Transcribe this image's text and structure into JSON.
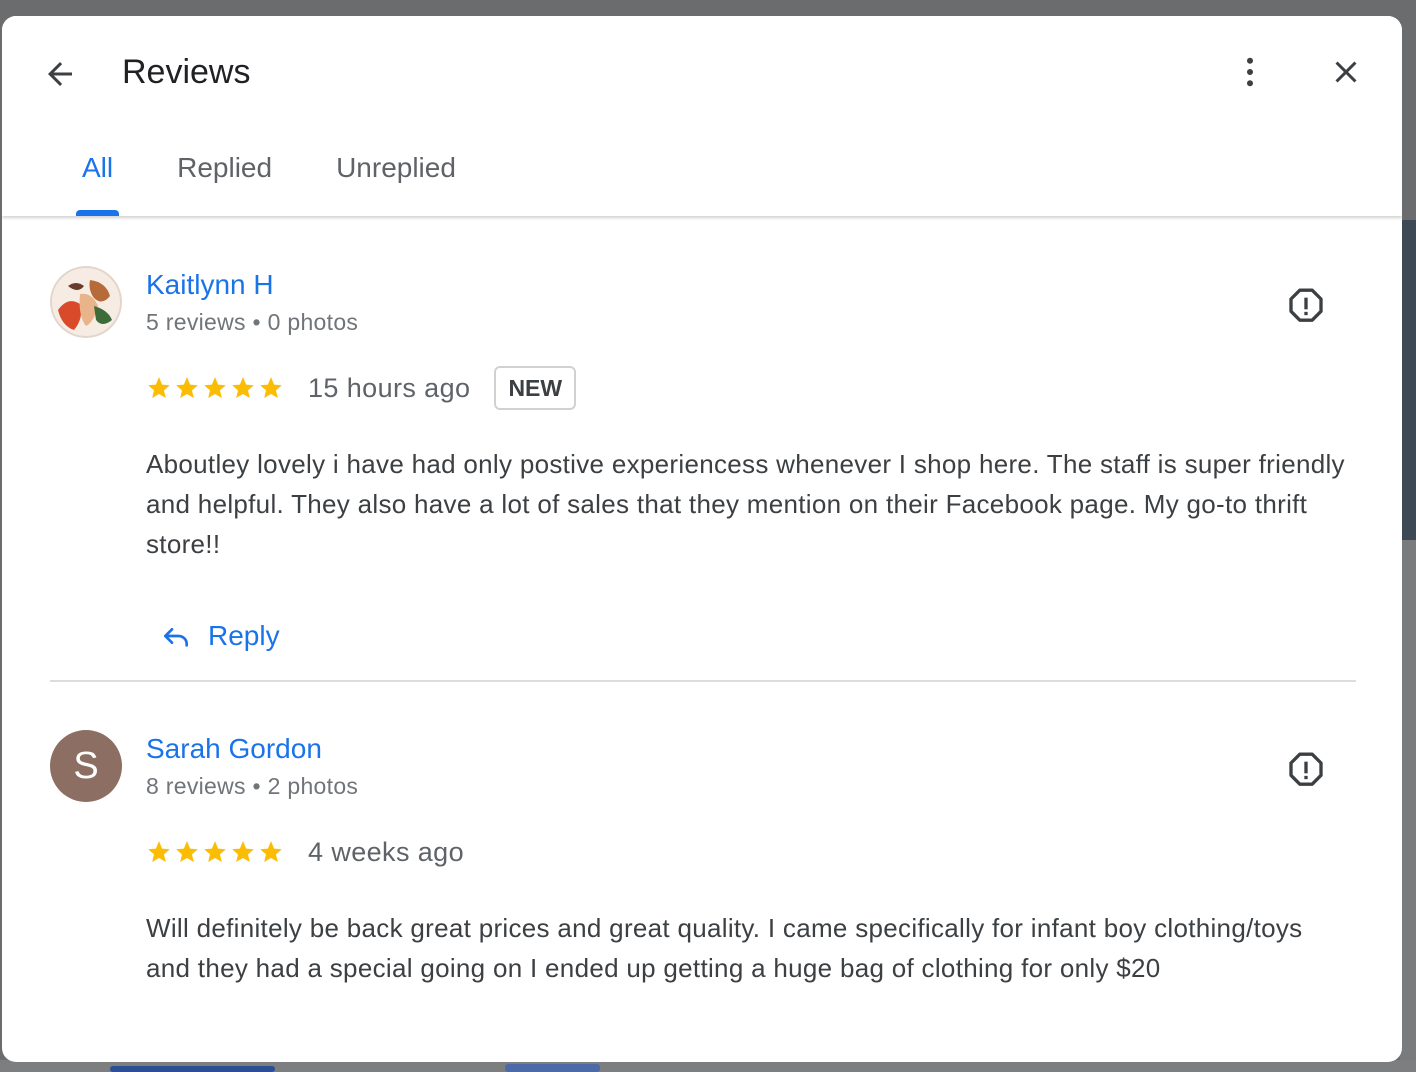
{
  "header": {
    "title": "Reviews"
  },
  "tabs": [
    {
      "label": "All",
      "active": true
    },
    {
      "label": "Replied",
      "active": false
    },
    {
      "label": "Unreplied",
      "active": false
    }
  ],
  "reviews": [
    {
      "name": "Kaitlynn H",
      "meta": "5 reviews • 0 photos",
      "rating": 5,
      "time": "15 hours ago",
      "badge": "NEW",
      "text": "Aboutley lovely i have had only postive experiencess whenever I shop here. The staff is super friendly and helpful. They also have a lot of sales that they mention on their Facebook page. My go-to thrift store!!",
      "reply_label": "Reply"
    },
    {
      "name": "Sarah Gordon",
      "avatar_letter": "S",
      "meta": "8 reviews • 2 photos",
      "rating": 5,
      "time": "4 weeks ago",
      "text": "Will definitely be back great prices and great quality. I came specifically for infant boy clothing/toys and they had a special going on I ended up getting a huge bag of clothing for only $20"
    }
  ],
  "icons": {
    "back": "arrow-left-icon",
    "more": "more-vert-icon",
    "close": "close-icon",
    "flag": "report-icon",
    "star": "star-icon",
    "reply": "reply-icon"
  },
  "colors": {
    "accent": "#1a73e8",
    "star": "#fbbc04",
    "avatar_s": "#8d6e63"
  }
}
